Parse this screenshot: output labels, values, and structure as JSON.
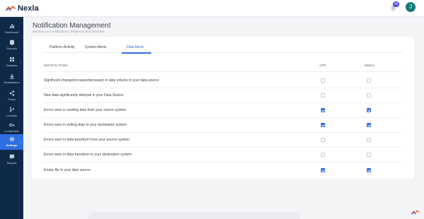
{
  "app": {
    "name": "Nexla"
  },
  "header": {
    "notification_count": "30",
    "avatar_initial": "J"
  },
  "sidebar": {
    "items": [
      {
        "label": "Dashboard",
        "icon": "bar-chart-icon",
        "active": false
      },
      {
        "label": "Sources",
        "icon": "database-icon",
        "active": false
      },
      {
        "label": "Datasets",
        "icon": "grid-icon",
        "active": false,
        "has_submenu": true
      },
      {
        "label": "Destinations",
        "icon": "download-arrow-icon",
        "active": false
      },
      {
        "label": "Flows",
        "icon": "share-icon",
        "active": false
      },
      {
        "label": "Lookups",
        "icon": "branch-icon",
        "active": false
      },
      {
        "label": "Credentials",
        "icon": "key-icon",
        "active": false
      },
      {
        "label": "Settings",
        "icon": "gear-icon",
        "active": true,
        "has_submenu": true
      },
      {
        "label": "Support",
        "icon": "chat-icon",
        "active": false
      }
    ]
  },
  "page": {
    "title": "Notification Management",
    "subtitle": "Manage your notifications, frequency and channels"
  },
  "tabs": [
    {
      "label": "Platform Activity",
      "active": false
    },
    {
      "label": "System Alerts",
      "active": false
    },
    {
      "label": "Data Alerts",
      "active": true
    }
  ],
  "table": {
    "columns": {
      "notification": "NOTIFICATION",
      "app": "APP",
      "email": "EMAIL"
    },
    "rows": [
      {
        "label": "Significant change(increase/decrease) in data volume in your data source",
        "app": false,
        "email": false
      },
      {
        "label": "New data significantly delayed in your Data Source",
        "app": false,
        "email": false
      },
      {
        "label": "Errors seen in reading data from your source system",
        "app": true,
        "email": true
      },
      {
        "label": "Errors seen in writing data to your destination system",
        "app": true,
        "email": true
      },
      {
        "label": "Errors seen in data transform from your source system",
        "app": false,
        "email": false
      },
      {
        "label": "Errors seen in data transform to your destination system",
        "app": false,
        "email": false
      },
      {
        "label": "Empty file in your data source",
        "app": true,
        "email": true
      }
    ]
  },
  "colors": {
    "sidebar_bg": "#0e2a47",
    "accent": "#2f6fe3",
    "avatar": "#13797b",
    "logo_red": "#e4572e"
  }
}
